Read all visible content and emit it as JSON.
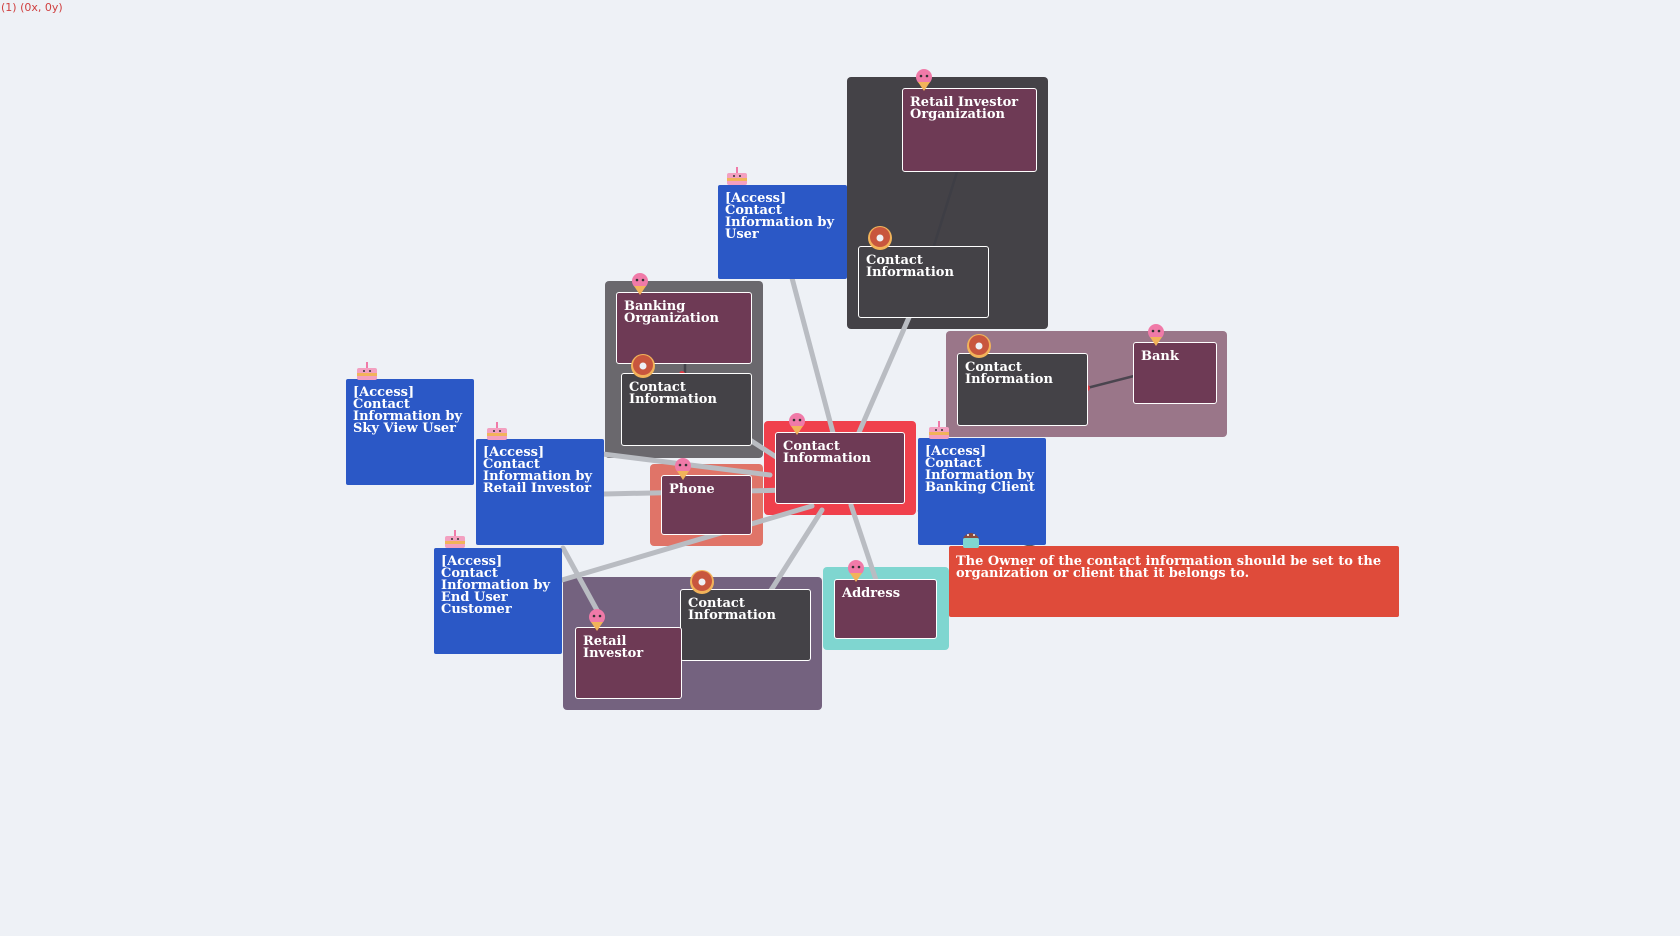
{
  "coords": "(1) (0x, 0y)",
  "colors": {
    "background": "#eef1f6",
    "entity": "#6e3a55",
    "dark_entity": "#444247",
    "access": "#2b58c6",
    "note": "#df4b3a",
    "focus": "#f0404c",
    "edge": "#b9bcc2",
    "edge_dark": "#3d3d45"
  },
  "nodes": {
    "retail_investor_org": {
      "label": "Retail Investor Organization",
      "icon": "ice-cream-icon"
    },
    "access_by_user": {
      "label": "[Access] Contact Information by User",
      "icon": "cake-icon"
    },
    "contact_info_top": {
      "label": "Contact Information",
      "icon": "donut-icon"
    },
    "banking_org": {
      "label": "Banking Organization",
      "icon": "ice-cream-icon"
    },
    "contact_info_banking": {
      "label": "Contact Information",
      "icon": "donut-icon"
    },
    "contact_info_bank": {
      "label": "Contact Information",
      "icon": "donut-icon"
    },
    "bank": {
      "label": "Bank",
      "icon": "ice-cream-icon"
    },
    "access_sky_view": {
      "label": "[Access] Contact Information by Sky View User",
      "icon": "cake-icon"
    },
    "access_retail_investor": {
      "label": "[Access] Contact Information by Retail Investor",
      "icon": "cake-icon"
    },
    "contact_info_main": {
      "label": "Contact Information",
      "icon": "ice-cream-icon"
    },
    "access_banking_client": {
      "label": "[Access] Contact Information by Banking Client",
      "icon": "cake-icon"
    },
    "phone": {
      "label": "Phone",
      "icon": "ice-cream-icon"
    },
    "access_end_user": {
      "label": "[Access] Contact Information by End User Customer",
      "icon": "cake-icon"
    },
    "contact_info_retail": {
      "label": "Contact Information",
      "icon": "donut-icon"
    },
    "retail_investor": {
      "label": "Retail Investor",
      "icon": "ice-cream-icon"
    },
    "address": {
      "label": "Address",
      "icon": "ice-cream-icon"
    },
    "note_owner": {
      "label": "The Owner of the contact information should be set to the organization or client that it belongs to.",
      "icon": "cupcake-icon"
    }
  }
}
